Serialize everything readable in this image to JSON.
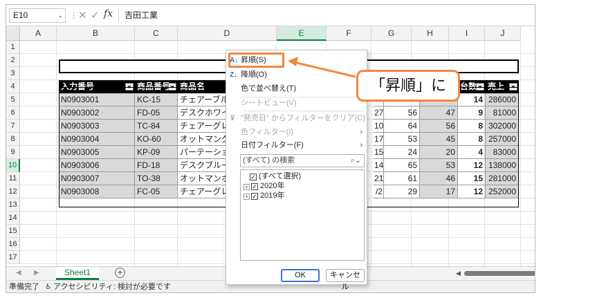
{
  "formula_bar": {
    "name_box": "E10",
    "cancel_icon": "✕",
    "enter_icon": "✓",
    "fx_label": "fx",
    "formula": "吉田工業"
  },
  "grid": {
    "columns": [
      "A",
      "B",
      "C",
      "D",
      "E",
      "F",
      "G",
      "H",
      "I",
      "J"
    ],
    "selected_column": "E",
    "rows": [
      "1",
      "2",
      "3",
      "4",
      "5",
      "6",
      "7",
      "8",
      "9",
      "10",
      "11",
      "12",
      "13",
      "14",
      "15",
      "16",
      "17"
    ],
    "selected_row": "10"
  },
  "table": {
    "headers": {
      "b": "入力番号",
      "c": "商品番号",
      "d": "商品名",
      "i": "台数",
      "j": "売上"
    },
    "rows": [
      {
        "id": "N0903001",
        "code": "KC-15",
        "name": "チェアーブル",
        "f": "",
        "g": "",
        "h": "",
        "i": "14",
        "j": "286000"
      },
      {
        "id": "N0903002",
        "code": "FD-05",
        "name": "デスクホワイ",
        "f": "27",
        "g": "56",
        "h": "47",
        "i": "9",
        "j": "81000"
      },
      {
        "id": "N0903003",
        "code": "TC-84",
        "name": "チェアーグレ",
        "f": "10",
        "g": "64",
        "h": "56",
        "i": "8",
        "j": "302000"
      },
      {
        "id": "N0903004",
        "code": "KO-60",
        "name": "オットマング",
        "f": "17",
        "g": "53",
        "h": "45",
        "i": "8",
        "j": "257000"
      },
      {
        "id": "N0903005",
        "code": "KP-09",
        "name": "パーテーション",
        "f": "15",
        "g": "24",
        "h": "20",
        "i": "4",
        "j": "83000"
      },
      {
        "id": "N0903006",
        "code": "FD-18",
        "name": "デスクブルー",
        "f": "14",
        "g": "65",
        "h": "53",
        "i": "12",
        "j": "138000"
      },
      {
        "id": "N0903007",
        "code": "TO-38",
        "name": "オットマンボ",
        "f": "21",
        "g": "61",
        "h": "46",
        "i": "15",
        "j": "281000"
      },
      {
        "id": "N0903008",
        "code": "FC-05",
        "name": "チェアーグレ",
        "f": "/2",
        "g": "29",
        "h": "17",
        "i": "12",
        "j": "252000"
      }
    ]
  },
  "filter_menu": {
    "sort_asc": "昇順(S)",
    "sort_desc": "降順(O)",
    "sort_by_color": "色で並べ替え(T)",
    "sheet_view": "シートビュー(V)",
    "clear_filter": "\"発売日\" からフィルターをクリア(C)",
    "color_filter": "色フィルター(I)",
    "date_filter": "日付フィルター(F)",
    "search_placeholder": "(すべて) の検索",
    "list": [
      {
        "label": "(すべて選択)",
        "checked": true,
        "expandable": false
      },
      {
        "label": "2020年",
        "checked": true,
        "expandable": true
      },
      {
        "label": "2019年",
        "checked": true,
        "expandable": true
      }
    ],
    "ok": "OK",
    "cancel": "キャンセル"
  },
  "callout": {
    "text": "「昇順」に",
    "color": "#f0883e"
  },
  "tabs": {
    "sheet1": "Sheet1",
    "add": "+"
  },
  "status": {
    "ready": "準備完了",
    "accessibility": "アクセシビリティ: 検討が必要です"
  },
  "colors": {
    "excel_green": "#107c41",
    "highlight_orange": "#f0883e",
    "header_black": "#000000",
    "data_gray": "#d9d9d9"
  }
}
